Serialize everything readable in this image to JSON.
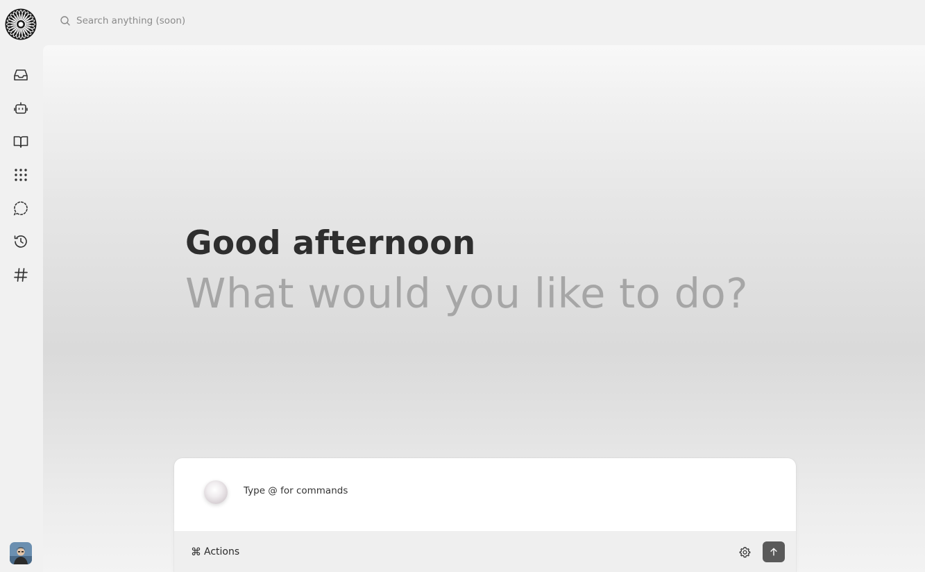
{
  "search": {
    "placeholder": "Search anything (soon)",
    "icon": "search-icon"
  },
  "sidebar": {
    "logo": "flower-logo",
    "items": [
      {
        "name": "inbox",
        "icon": "inbox-icon"
      },
      {
        "name": "agents",
        "icon": "bot-icon"
      },
      {
        "name": "library",
        "icon": "book-open-icon"
      },
      {
        "name": "apps",
        "icon": "grid-dots-icon"
      },
      {
        "name": "chat",
        "icon": "dashed-chat-icon"
      },
      {
        "name": "history",
        "icon": "history-icon"
      },
      {
        "name": "channels",
        "icon": "hash-icon"
      }
    ],
    "avatar": "user-avatar"
  },
  "main": {
    "greeting": "Good afternoon",
    "prompt": "What would you like to do?"
  },
  "composer": {
    "placeholder": "Type @ for commands",
    "actions_symbol": "⌘",
    "actions_label": "Actions"
  },
  "colors": {
    "background": "#f1f1f1",
    "greeting": "#2e2e2e",
    "prompt": "#a6a6a6",
    "send_button": "#5a5a5a"
  }
}
